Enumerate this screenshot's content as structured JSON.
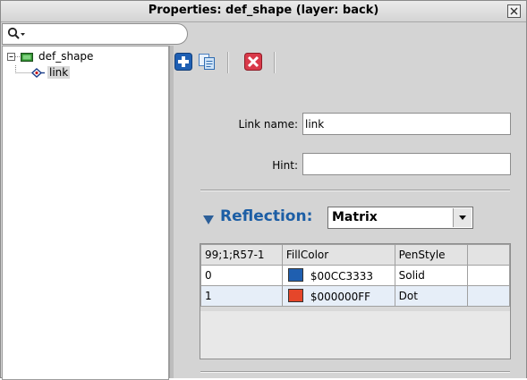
{
  "window": {
    "title": "Properties: def_shape (layer: back)",
    "close_glyph": "×"
  },
  "search": {
    "value": "",
    "icon": "search-icon"
  },
  "tree": {
    "items": [
      {
        "expander": "⊟",
        "icon": "shape-icon",
        "label": "def_shape"
      },
      {
        "icon": "link-icon",
        "label": "link",
        "selected": true
      }
    ]
  },
  "toolbar": {
    "buttons": [
      "add-icon",
      "duplicate-icon",
      "delete-icon"
    ]
  },
  "form": {
    "link_name_label": "Link name:",
    "link_name_value": "link",
    "hint_label": "Hint:",
    "hint_value": ""
  },
  "reflection": {
    "label": "Reflection:",
    "mode": "Matrix"
  },
  "table": {
    "headers": [
      "99;1;R57-1",
      "FillColor",
      "PenStyle",
      ""
    ],
    "rows": [
      {
        "index": "0",
        "fill": "$00CC3333",
        "fill_color": "#1f5fb0",
        "pen": "Solid"
      },
      {
        "index": "1",
        "fill": "$000000FF",
        "fill_color": "#e5462a",
        "pen": "Dot"
      }
    ]
  },
  "colors": {
    "accent": "#1c5ea5"
  }
}
